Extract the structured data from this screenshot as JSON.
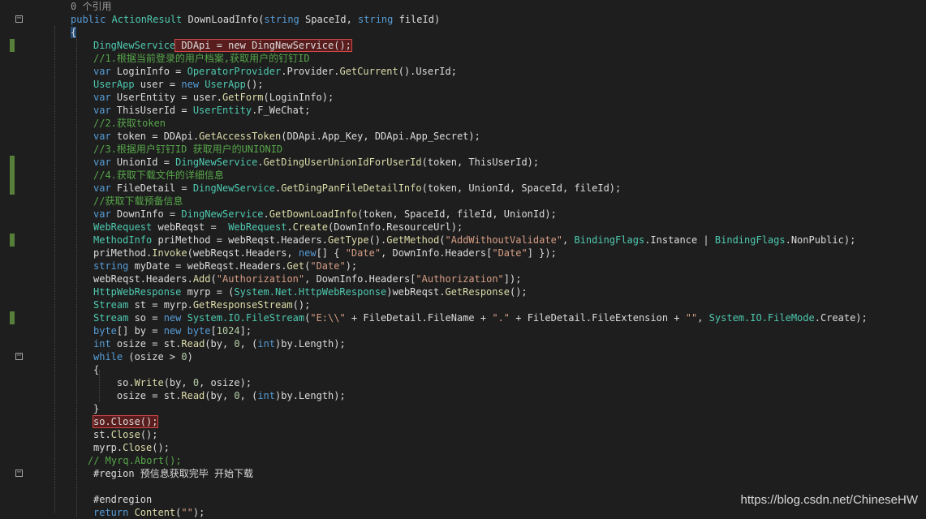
{
  "codelens": "0 个引用",
  "watermark": "https://blog.csdn.net/ChineseHW",
  "lines": [
    [
      [
        "codelens",
        "0 个引用"
      ]
    ],
    [
      [
        "k",
        "public "
      ],
      [
        "t",
        "ActionResult "
      ],
      [
        "pl",
        "DownLoadInfo("
      ],
      [
        "k",
        "string "
      ],
      [
        "pl",
        "SpaceId, "
      ],
      [
        "k",
        "string "
      ],
      [
        "pl",
        "fileId)"
      ]
    ],
    [
      [
        "hl-brace",
        "{"
      ]
    ],
    [
      [
        "t",
        "DingNewService"
      ],
      [
        "hl-red",
        " DDApi = new DingNewService();"
      ]
    ],
    [
      [
        "c",
        "//1.根据当前登录的用户档案,获取用户的钉钉ID"
      ]
    ],
    [
      [
        "k",
        "var "
      ],
      [
        "pl",
        "LoginInfo = "
      ],
      [
        "t",
        "OperatorProvider"
      ],
      [
        "pl",
        "."
      ],
      [
        "pl",
        "Provider."
      ],
      [
        "m",
        "GetCurrent"
      ],
      [
        "pl",
        "()."
      ],
      [
        "pl",
        "UserId;"
      ]
    ],
    [
      [
        "t",
        "UserApp "
      ],
      [
        "pl",
        "user = "
      ],
      [
        "k",
        "new "
      ],
      [
        "t",
        "UserApp"
      ],
      [
        "pl",
        "();"
      ]
    ],
    [
      [
        "k",
        "var "
      ],
      [
        "pl",
        "UserEntity = user."
      ],
      [
        "m",
        "GetForm"
      ],
      [
        "pl",
        "(LoginInfo);"
      ]
    ],
    [
      [
        "k",
        "var "
      ],
      [
        "pl",
        "ThisUserId = "
      ],
      [
        "t",
        "UserEntity"
      ],
      [
        "pl",
        ".F_WeChat;"
      ]
    ],
    [
      [
        "c",
        "//2.获取token"
      ]
    ],
    [
      [
        "k",
        "var "
      ],
      [
        "pl",
        "token = DDApi."
      ],
      [
        "m",
        "GetAccessToken"
      ],
      [
        "pl",
        "(DDApi.App_Key, DDApi.App_Secret);"
      ]
    ],
    [
      [
        "c",
        "//3.根据用户钉钉ID 获取用户的UNIONID"
      ]
    ],
    [
      [
        "k",
        "var "
      ],
      [
        "pl",
        "UnionId = "
      ],
      [
        "t",
        "DingNewService"
      ],
      [
        "pl",
        "."
      ],
      [
        "m",
        "GetDingUserUnionIdForUserId"
      ],
      [
        "pl",
        "(token, ThisUserId);"
      ]
    ],
    [
      [
        "c",
        "//4.获取下载文件的详细信息"
      ]
    ],
    [
      [
        "k",
        "var "
      ],
      [
        "pl",
        "FileDetail = "
      ],
      [
        "t",
        "DingNewService"
      ],
      [
        "pl",
        "."
      ],
      [
        "m",
        "GetDingPanFileDetailInfo"
      ],
      [
        "pl",
        "(token, UnionId, SpaceId, fileId);"
      ]
    ],
    [
      [
        "c",
        "//获取下载预备信息"
      ]
    ],
    [
      [
        "k",
        "var "
      ],
      [
        "pl",
        "DownInfo = "
      ],
      [
        "t",
        "DingNewService"
      ],
      [
        "pl",
        "."
      ],
      [
        "m",
        "GetDownLoadInfo"
      ],
      [
        "pl",
        "(token, SpaceId, fileId, UnionId);"
      ]
    ],
    [
      [
        "t",
        "WebRequest "
      ],
      [
        "pl",
        "webReqst =  "
      ],
      [
        "t",
        "WebRequest"
      ],
      [
        "pl",
        "."
      ],
      [
        "m",
        "Create"
      ],
      [
        "pl",
        "(DownInfo.ResourceUrl);"
      ]
    ],
    [
      [
        "t",
        "MethodInfo "
      ],
      [
        "pl",
        "priMethod = webReqst.Headers."
      ],
      [
        "m",
        "GetType"
      ],
      [
        "pl",
        "()."
      ],
      [
        "m",
        "GetMethod"
      ],
      [
        "pl",
        "("
      ],
      [
        "s",
        "\"AddWithoutValidate\""
      ],
      [
        "pl",
        ", "
      ],
      [
        "t",
        "BindingFlags"
      ],
      [
        "pl",
        ".Instance | "
      ],
      [
        "t",
        "BindingFlags"
      ],
      [
        "pl",
        ".NonPublic);"
      ]
    ],
    [
      [
        "pl",
        "priMethod."
      ],
      [
        "m",
        "Invoke"
      ],
      [
        "pl",
        "(webReqst.Headers, "
      ],
      [
        "k",
        "new"
      ],
      [
        "pl",
        "[] { "
      ],
      [
        "s",
        "\"Date\""
      ],
      [
        "pl",
        ", DownInfo.Headers["
      ],
      [
        "s",
        "\"Date\""
      ],
      [
        "pl",
        "] });"
      ]
    ],
    [
      [
        "k",
        "string "
      ],
      [
        "pl",
        "myDate = webReqst.Headers."
      ],
      [
        "m",
        "Get"
      ],
      [
        "pl",
        "("
      ],
      [
        "s",
        "\"Date\""
      ],
      [
        "pl",
        ");"
      ]
    ],
    [
      [
        "pl",
        "webReqst.Headers."
      ],
      [
        "m",
        "Add"
      ],
      [
        "pl",
        "("
      ],
      [
        "s",
        "\"Authorization\""
      ],
      [
        "pl",
        ", DownInfo.Headers["
      ],
      [
        "s",
        "\"Authorization\""
      ],
      [
        "pl",
        "]);"
      ]
    ],
    [
      [
        "t",
        "HttpWebResponse "
      ],
      [
        "pl",
        "myrp = ("
      ],
      [
        "t",
        "System.Net.HttpWebResponse"
      ],
      [
        "pl",
        ")webReqst."
      ],
      [
        "m",
        "GetResponse"
      ],
      [
        "pl",
        "();"
      ]
    ],
    [
      [
        "t",
        "Stream "
      ],
      [
        "pl",
        "st = myrp."
      ],
      [
        "m",
        "GetResponseStream"
      ],
      [
        "pl",
        "();"
      ]
    ],
    [
      [
        "t",
        "Stream "
      ],
      [
        "pl",
        "so = "
      ],
      [
        "k",
        "new "
      ],
      [
        "t",
        "System.IO.FileStream"
      ],
      [
        "pl",
        "("
      ],
      [
        "s",
        "\"E:\\\\\""
      ],
      [
        "pl",
        " + FileDetail.FileName + "
      ],
      [
        "s",
        "\".\""
      ],
      [
        "pl",
        " + FileDetail.FileExtension + "
      ],
      [
        "s",
        "\"\""
      ],
      [
        "pl",
        ", "
      ],
      [
        "t",
        "System.IO.FileMode"
      ],
      [
        "pl",
        ".Create);"
      ]
    ],
    [
      [
        "k",
        "byte"
      ],
      [
        "pl",
        "[] by = "
      ],
      [
        "k",
        "new byte"
      ],
      [
        "pl",
        "["
      ],
      [
        "n",
        "1024"
      ],
      [
        "pl",
        "];"
      ]
    ],
    [
      [
        "k",
        "int "
      ],
      [
        "pl",
        "osize = st."
      ],
      [
        "m",
        "Read"
      ],
      [
        "pl",
        "(by, "
      ],
      [
        "n",
        "0"
      ],
      [
        "pl",
        ", ("
      ],
      [
        "k",
        "int"
      ],
      [
        "pl",
        ")by.Length);"
      ]
    ],
    [
      [
        "k",
        "while "
      ],
      [
        "pl",
        "(osize > "
      ],
      [
        "n",
        "0"
      ],
      [
        "pl",
        ")"
      ]
    ],
    [
      [
        "pl",
        "{"
      ]
    ],
    [
      [
        "pl",
        "    so."
      ],
      [
        "m",
        "Write"
      ],
      [
        "pl",
        "(by, "
      ],
      [
        "n",
        "0"
      ],
      [
        "pl",
        ", osize);"
      ]
    ],
    [
      [
        "pl",
        "    osize = st."
      ],
      [
        "m",
        "Read"
      ],
      [
        "pl",
        "(by, "
      ],
      [
        "n",
        "0"
      ],
      [
        "pl",
        ", ("
      ],
      [
        "k",
        "int"
      ],
      [
        "pl",
        ")by.Length);"
      ]
    ],
    [
      [
        "pl",
        "}"
      ]
    ],
    [
      [
        "hl-red",
        "so.Close();"
      ]
    ],
    [
      [
        "pl",
        "st."
      ],
      [
        "m",
        "Close"
      ],
      [
        "pl",
        "();"
      ]
    ],
    [
      [
        "pl",
        "myrp."
      ],
      [
        "m",
        "Close"
      ],
      [
        "pl",
        "();"
      ]
    ],
    [
      [
        "c",
        "// Myrq.Abort();"
      ]
    ],
    [
      [
        "pl",
        "#region 预信息获取完毕 开始下载"
      ]
    ],
    [
      [
        "pl",
        ""
      ]
    ],
    [
      [
        "pl",
        "#endregion"
      ]
    ],
    [
      [
        "k",
        "return "
      ],
      [
        "m",
        "Content"
      ],
      [
        "pl",
        "("
      ],
      [
        "s",
        "\"\""
      ],
      [
        "pl",
        ");"
      ]
    ]
  ]
}
